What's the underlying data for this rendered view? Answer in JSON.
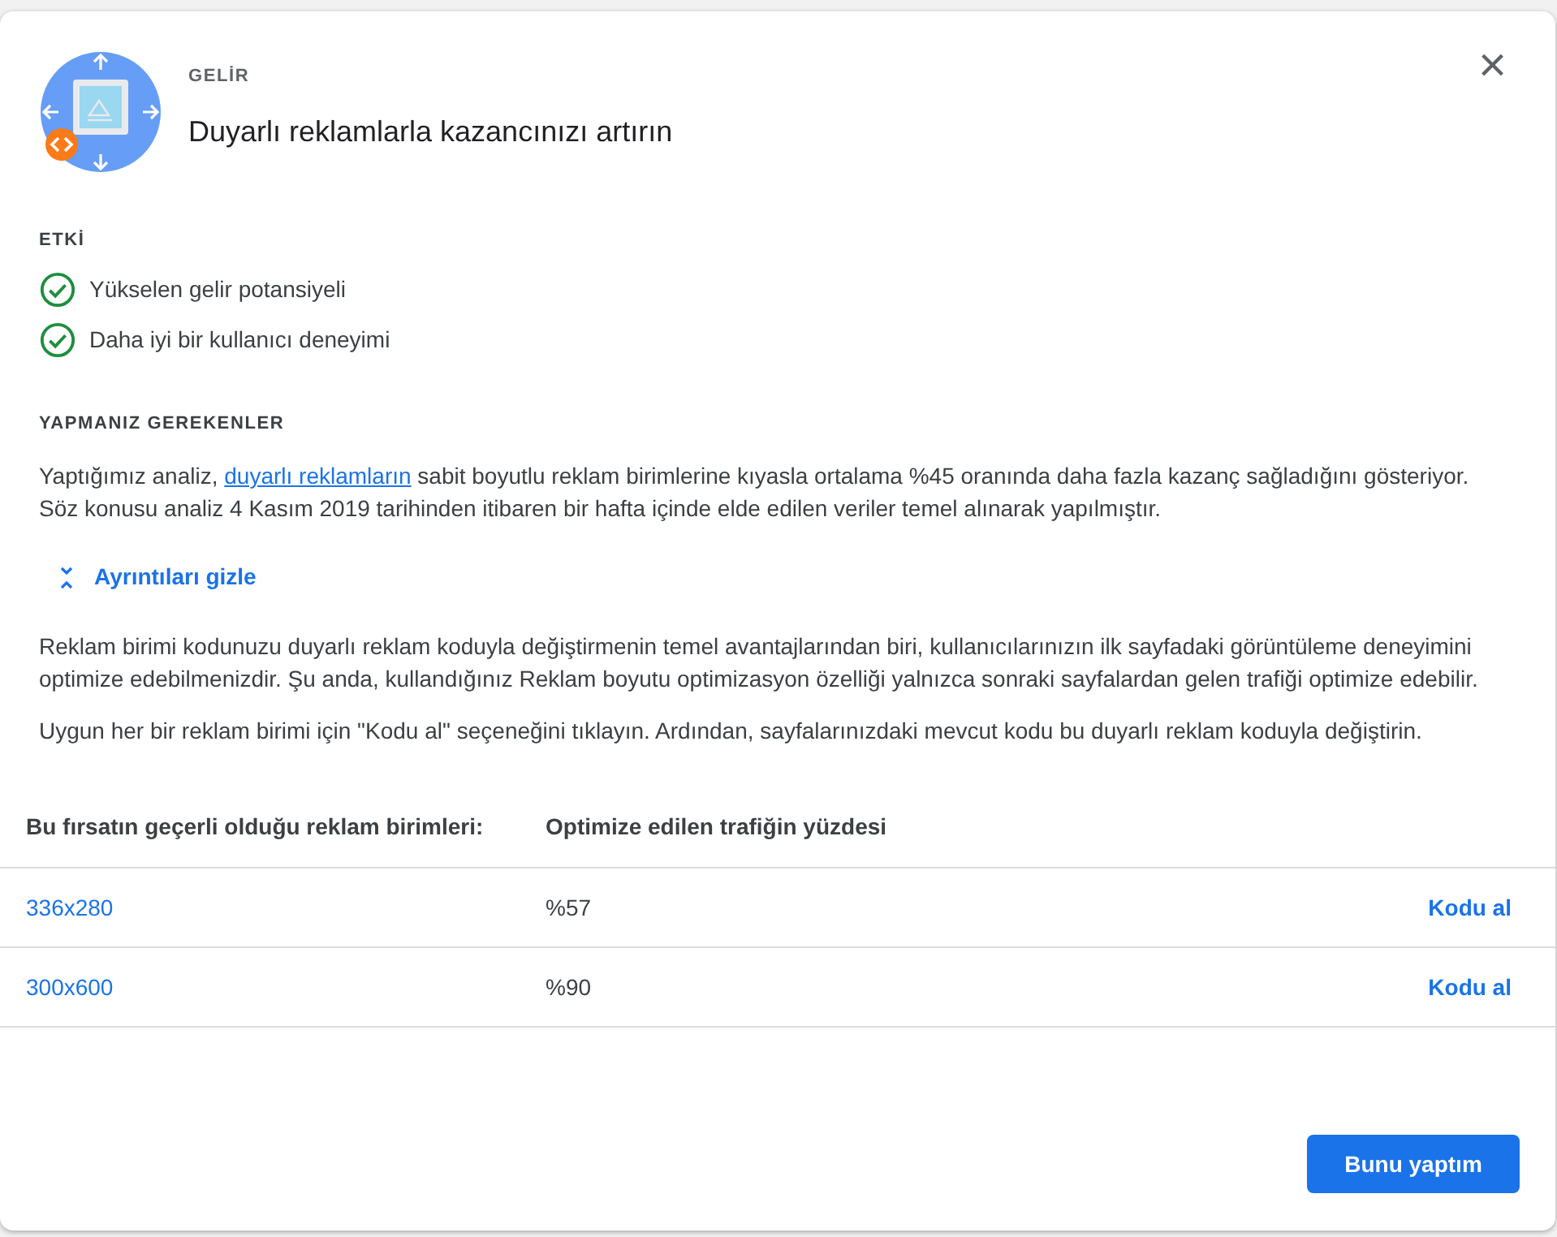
{
  "header": {
    "category": "GELİR",
    "title": "Duyarlı reklamlarla kazancınızı artırın",
    "close": "×"
  },
  "impact": {
    "heading": "ETKİ",
    "items": [
      {
        "label": "Yükselen gelir potansiyeli",
        "checked": true
      },
      {
        "label": "Daha iyi bir kullanıcı deneyimi",
        "checked": true
      }
    ]
  },
  "todo": {
    "heading": "YAPMANIZ GEREKENLER",
    "intro": {
      "before": "Yaptığımız analiz, ",
      "link": "duyarlı reklamların",
      "after": " sabit boyutlu reklam birimlerine kıyasla ortalama %45 oranında daha fazla kazanç sağladığını gösteriyor. Söz konusu analiz 4 Kasım 2019 tarihinden itibaren bir hafta içinde elde edilen veriler temel alınarak yapılmıştır."
    },
    "toggle": {
      "label": "Ayrıntıları gizle",
      "expanded": true
    },
    "details": [
      "Reklam birimi kodunuzu duyarlı reklam koduyla değiştirmenin temel avantajlarından biri, kullanıcılarınızın ilk sayfadaki görüntüleme deneyimini optimize edebilmenizdir. Şu anda, kullandığınız Reklam boyutu optimizasyon özelliği yalnızca sonraki sayfalardan gelen trafiği optimize edebilir.",
      "Uygun her bir reklam birimi için \"Kodu al\" seçeneğini tıklayın. Ardından, sayfalarınızdaki mevcut kodu bu duyarlı reklam koduyla değiştirin."
    ]
  },
  "table": {
    "columns": [
      "Bu fırsatın geçerli olduğu reklam birimleri:",
      "Optimize edilen trafiğin yüzdesi"
    ],
    "rows": [
      {
        "unit": "336x280",
        "percent": "%57",
        "action": "Kodu al"
      },
      {
        "unit": "300x600",
        "percent": "%90",
        "action": "Kodu al"
      }
    ]
  },
  "primary_button": "Bunu yaptım"
}
